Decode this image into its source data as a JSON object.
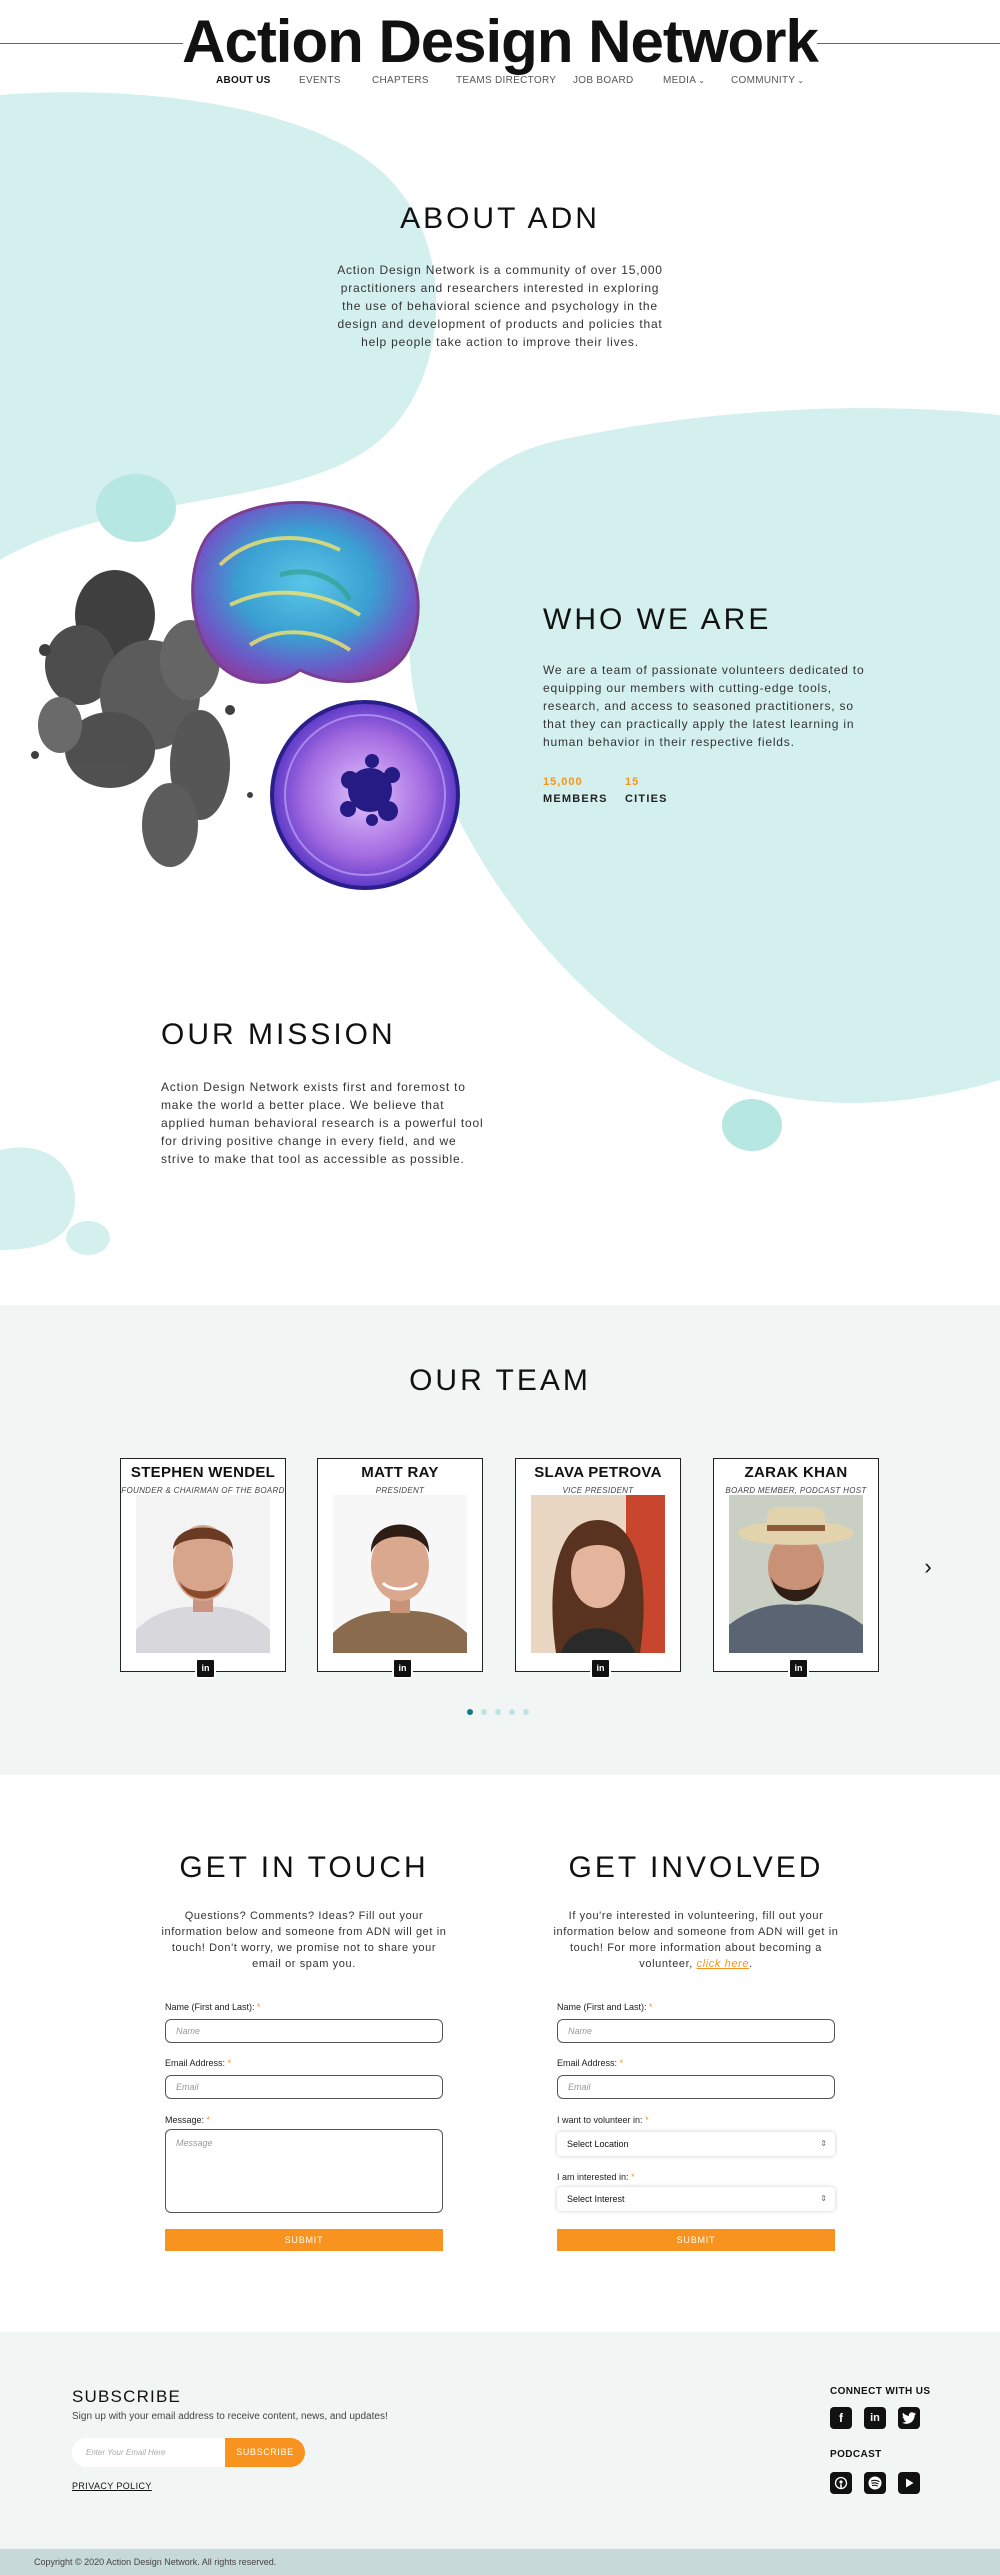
{
  "site": {
    "title": "Action Design Network"
  },
  "nav": {
    "items": [
      {
        "label": "ABOUT US",
        "active": true
      },
      {
        "label": "EVENTS"
      },
      {
        "label": "CHAPTERS"
      },
      {
        "label": "TEAMS DIRECTORY"
      },
      {
        "label": "JOB BOARD"
      },
      {
        "label": "MEDIA",
        "dropdown": true
      },
      {
        "label": "COMMUNITY",
        "dropdown": true
      }
    ]
  },
  "colors": {
    "accent": "#f7941d",
    "teal_blob": "#d4f0ee",
    "teal_dark": "#0e7b86",
    "section_bg": "#f1f6f5"
  },
  "about": {
    "title": "ABOUT ADN",
    "lines": [
      "Action Design Network is a community of over 15,000",
      "practitioners and researchers interested in exploring",
      "the use of behavioral science and psychology in the",
      "design and development of products and policies that",
      "help people take action to improve their lives."
    ]
  },
  "who": {
    "title": "WHO WE ARE",
    "lines": [
      "We are a team of passionate volunteers dedicated to",
      "equipping our members with cutting-edge tools,",
      "research, and access to seasoned practitioners, so",
      "that they can practically apply the latest learning in",
      "human behavior in their respective fields."
    ],
    "stats": [
      {
        "value": "15,000",
        "label": "MEMBERS"
      },
      {
        "value": "15",
        "label": "CITIES"
      }
    ]
  },
  "mission": {
    "title": "OUR MISSION",
    "lines": [
      "Action Design Network exists first and foremost to",
      "make the world a better place. We believe that",
      "applied human behavioral research is a powerful tool",
      "for driving positive change in every field, and we",
      "strive to make that tool as accessible as possible."
    ]
  },
  "team": {
    "title": "OUR TEAM",
    "members": [
      {
        "name": "STEPHEN WENDEL",
        "role": "FOUNDER & CHAIRMAN OF THE BOARD"
      },
      {
        "name": "MATT RAY",
        "role": "PRESIDENT"
      },
      {
        "name": "SLAVA PETROVA",
        "role": "VICE PRESIDENT"
      },
      {
        "name": "ZARAK KHAN",
        "role": "BOARD MEMBER, PODCAST HOST"
      }
    ],
    "linkedin_icon": "linkedin-icon",
    "next_icon": "chevron-right-icon",
    "pages": 5,
    "current_page": 1
  },
  "contact": {
    "title": "GET IN TOUCH",
    "lines": [
      "Questions? Comments? Ideas? Fill out your",
      "information below and someone from ADN will get in",
      "touch! Don't worry, we promise not to share your",
      "email or spam you."
    ],
    "name_label": "Name (First and Last):",
    "name_placeholder": "Name",
    "email_label": "Email Address:",
    "email_placeholder": "Email",
    "message_label": "Message:",
    "message_placeholder": "Message",
    "submit": "SUBMIT",
    "required_mark": "*"
  },
  "involved": {
    "title": "GET INVOLVED",
    "lines": [
      "If you're interested in volunteering, fill out your",
      "information below and someone from ADN will get in",
      "touch! For more information about becoming a"
    ],
    "last_line_prefix": "volunteer, ",
    "link_text": "click here",
    "last_line_suffix": ".",
    "name_label": "Name (First and Last):",
    "name_placeholder": "Name",
    "email_label": "Email Address:",
    "email_placeholder": "Email",
    "volunteer_label": "I  want to volunteer in:",
    "volunteer_value": "Select Location",
    "interest_label": "I am interested in:",
    "interest_value": "Select Interest",
    "submit": "SUBMIT",
    "required_mark": "*"
  },
  "footer": {
    "subscribe_title": "SUBSCRIBE",
    "subscribe_desc": "Sign up with your email address to receive content, news, and updates!",
    "email_placeholder": "Enter Your Email Here",
    "subscribe_button": "SUBSCRIBE",
    "privacy": "PRIVACY POLICY",
    "connect_title": "CONNECT WITH US",
    "connect_icons": [
      "facebook-icon",
      "linkedin-icon",
      "twitter-icon"
    ],
    "podcast_title": "PODCAST",
    "podcast_icons": [
      "apple-podcasts-icon",
      "spotify-icon",
      "youtube-icon"
    ],
    "copyright": "Copyright © 2020 Action Design Network. All rights reserved."
  }
}
